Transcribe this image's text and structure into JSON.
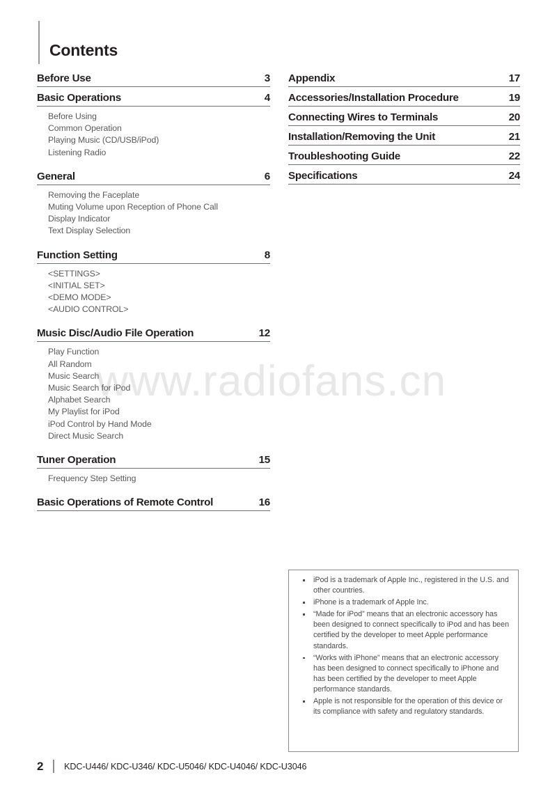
{
  "document": {
    "page_title": "Contents",
    "watermark": "www.radiofans.cn"
  },
  "left_column": {
    "sections": [
      {
        "title": "Before Use",
        "page": "3",
        "items": []
      },
      {
        "title": "Basic Operations",
        "page": "4",
        "items": [
          "Before Using",
          "Common Operation",
          "Playing Music (CD/USB/iPod)",
          "Listening Radio"
        ]
      },
      {
        "title": "General",
        "page": "6",
        "items": [
          "Removing the Faceplate",
          "Muting Volume upon Reception of Phone Call",
          "Display Indicator",
          "Text Display Selection"
        ]
      },
      {
        "title": "Function Setting",
        "page": "8",
        "items": [
          "<SETTINGS>",
          "<INITIAL SET>",
          "<DEMO MODE>",
          "<AUDIO CONTROL>"
        ]
      },
      {
        "title": "Music Disc/Audio File Operation",
        "page": "12",
        "items": [
          "Play Function",
          "All Random",
          "Music Search",
          "Music Search for iPod",
          "Alphabet Search",
          "My Playlist for iPod",
          "iPod Control by Hand Mode",
          "Direct Music Search"
        ]
      },
      {
        "title": "Tuner Operation",
        "page": "15",
        "items": [
          "Frequency Step Setting"
        ]
      },
      {
        "title": "Basic Operations of Remote Control",
        "page": "16",
        "items": []
      }
    ]
  },
  "right_column": {
    "sections": [
      {
        "title": "Appendix",
        "page": "17",
        "items": []
      },
      {
        "title": "Accessories/Installation Procedure",
        "page": "19",
        "items": []
      },
      {
        "title": "Connecting Wires to Terminals",
        "page": "20",
        "items": []
      },
      {
        "title": "Installation/Removing the Unit",
        "page": "21",
        "items": []
      },
      {
        "title": "Troubleshooting Guide",
        "page": "22",
        "items": []
      },
      {
        "title": "Specifications",
        "page": "24",
        "items": []
      }
    ]
  },
  "trademark_notice": {
    "items": [
      "iPod is a trademark of Apple Inc., registered in the U.S. and other countries.",
      "iPhone is a trademark of Apple Inc.",
      "“Made for iPod” means that an electronic accessory has been designed to connect specifically to iPod and has been certified by the developer to meet Apple performance standards.",
      "“Works with iPhone” means that an electronic accessory has been designed to connect specifically to iPhone and has been certified by the developer to meet Apple performance standards.",
      "Apple is not responsible for the operation of this device or its compliance with safety and regulatory standards."
    ]
  },
  "footer": {
    "page_number": "2",
    "models": "KDC-U446/ KDC-U346/ KDC-U5046/ KDC-U4046/ KDC-U3046"
  },
  "colors": {
    "text": "#231f20",
    "subitem_text": "#58595b",
    "rule": "#6d6e71",
    "box_border": "#8d8d8d",
    "watermark": "#e8e8e8"
  }
}
